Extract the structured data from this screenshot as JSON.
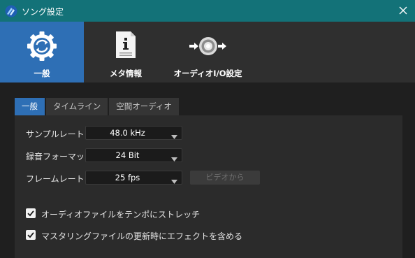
{
  "window": {
    "title": "ソング設定"
  },
  "categories": [
    {
      "label": "一般",
      "icon": "sync-gear-icon",
      "active": true
    },
    {
      "label": "メタ情報",
      "icon": "info-document-icon",
      "active": false
    },
    {
      "label": "オーディオI/O設定",
      "icon": "audio-io-icon",
      "active": false
    }
  ],
  "tabs": [
    {
      "label": "一般",
      "active": true
    },
    {
      "label": "タイムライン",
      "active": false
    },
    {
      "label": "空間オーディオ",
      "active": false
    }
  ],
  "settings": {
    "sample_rate": {
      "label": "サンプルレート",
      "value": "48.0 kHz"
    },
    "record_format": {
      "label": "録音フォーマット",
      "value": "24 Bit"
    },
    "frame_rate": {
      "label": "フレームレート",
      "value": "25 fps"
    },
    "from_video_label": "ビデオから"
  },
  "options": [
    {
      "label": "オーディオファイルをテンポにストレッチ",
      "checked": true
    },
    {
      "label": "マスタリングファイルの更新時にエフェクトを含める",
      "checked": true
    }
  ],
  "colors": {
    "titlebar": "#137278",
    "accent": "#2e6fb5",
    "background": "#1f1f1f"
  }
}
